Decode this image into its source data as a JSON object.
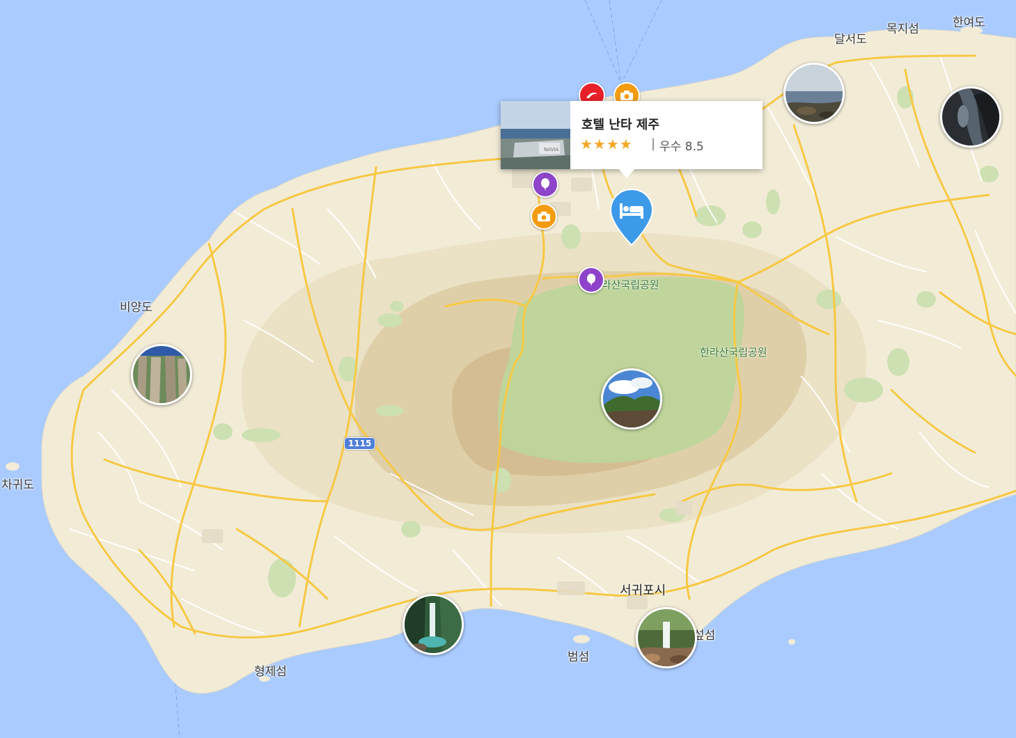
{
  "map": {
    "labels": {
      "dalseodo": "달서도",
      "mokjiseom": "목지섬",
      "hanyeodo": "한여도",
      "biyangdo": "비양도",
      "chagwido": "차귀도",
      "hyeongjeseom": "형제섬",
      "beomseom": "범섬",
      "seogwipo": "서귀포시",
      "seopseom": "섶섬",
      "hallasan_park_north": "한라산국립공원",
      "hallasan_park_east": "한라산국립공원"
    },
    "route_shield": "1115",
    "colors": {
      "sea": "#aacbff",
      "land": "#f2ecd7",
      "mountain_outer": "#e8dcbc",
      "mountain_mid": "#dcc9a2",
      "mountain_inner": "#cfb58a",
      "park": "#c3d697",
      "road_major": "#f7c843",
      "road_minor": "#ffffff",
      "hotel_pin": "#3d9ae8",
      "poi_purple": "#8e44c9",
      "poi_orange": "#f39c12",
      "poi_red": "#e8202a",
      "star": "#f5a623"
    }
  },
  "popup": {
    "hotel_name": "호텔 난타 제주",
    "stars": "★★★★",
    "divider": "|",
    "rating_text": "우수 8.5"
  },
  "markers": {
    "photos": [
      "coast-rocks-photo",
      "dark-cave-photo",
      "cliff-photo",
      "hallasan-peak-photo",
      "waterfall-west-photo",
      "waterfall-seogwipo-photo"
    ],
    "pois": [
      "balloon-icon",
      "camera-icon",
      "camera-icon",
      "balloon-icon",
      "dolphin-icon",
      "camera-icon"
    ]
  }
}
